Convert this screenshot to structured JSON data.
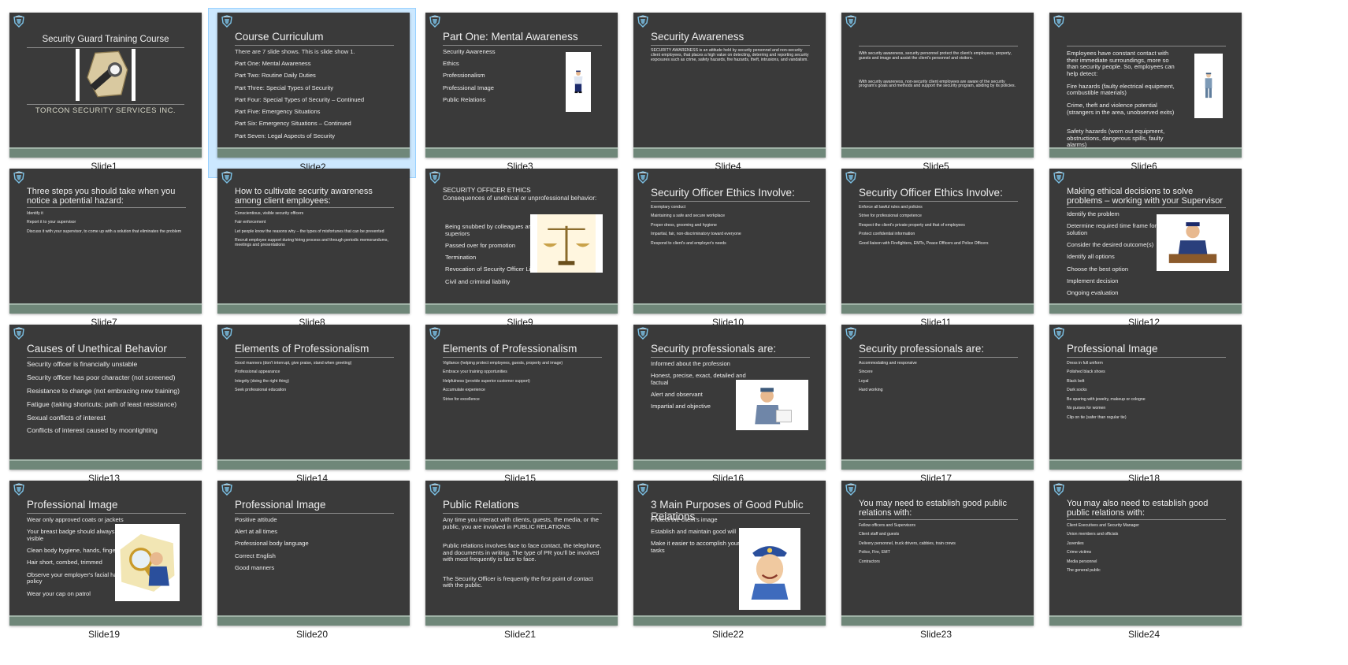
{
  "view": {
    "selected_slide": 2,
    "colors": {
      "slide_bg": "#3a3a3a",
      "footer": "#6f8779",
      "selection_bg": "#cce8ff",
      "selection_border": "#99d1ff",
      "logo": "#7cc3e8"
    }
  },
  "slides": [
    {
      "label": "Slide1",
      "layout": "cover",
      "title": "Security  Guard Training Course",
      "company": "TORCON SECURITY SERVICES INC.",
      "image": "flashlight-badge-image"
    },
    {
      "label": "Slide2",
      "layout": "list",
      "title": "Course Curriculum",
      "intro": "There are 7 slide shows.  This is slide show 1.",
      "size": "m",
      "items": [
        "Part One: Mental Awareness",
        "Part Two: Routine Daily Duties",
        "Part Three: Special Types of Security",
        "Part Four: Special Types of Security – Continued",
        "Part Five: Emergency Situations",
        "Part Six: Emergency Situations – Continued",
        "Part Seven: Legal Aspects of Security"
      ]
    },
    {
      "label": "Slide3",
      "layout": "list-image",
      "title": "Part One: Mental Awareness",
      "size": "m",
      "image": "security-officer-image",
      "items": [
        "Security Awareness",
        "Ethics",
        "Professionalism",
        "Professional Image",
        "Public Relations"
      ]
    },
    {
      "label": "Slide4",
      "layout": "paras",
      "title": "Security Awareness",
      "size": "s",
      "paras": [
        "SECURITY AWARENESS is an attitude held by security personnel and non-security client employees, that places a high value on detecting, deterring and reporting security exposures such as crime, safety hazards, fire hazards, theft, intrusions, and vandalism."
      ]
    },
    {
      "label": "Slide5",
      "layout": "paras",
      "title": "",
      "size": "s",
      "paras": [
        "With security awareness, security personnel protect the client's employees, property, guests and image and assist the client's personnel and visitors.",
        "With security awareness, non-security client employees are aware of the security program's goals and methods and support the security program, abiding by its policies."
      ]
    },
    {
      "label": "Slide6",
      "layout": "paras-image",
      "title": "",
      "size": "m",
      "image": "guard-standing-image",
      "paras": [
        "Employees have constant contact with their immediate surroundings, more so than security people.  So, employees can help detect:",
        "Fire hazards (faulty electrical equipment, combustible materials)",
        "Crime, theft and violence potential (strangers in the area, unobserved exits)",
        "Safety hazards (worn out equipment, obstructions, dangerous spills, faulty alarms)"
      ]
    },
    {
      "label": "Slide7",
      "layout": "list",
      "title": "Three steps you should take when you notice a potential hazard:",
      "size": "s",
      "items": [
        "Identify it",
        "Report it to your supervisor",
        "Discuss it with your supervisor, to come up with a solution that eliminates the problem"
      ]
    },
    {
      "label": "Slide8",
      "layout": "list",
      "title": "How to cultivate security awareness among client employees:",
      "size": "s",
      "items": [
        "Conscientious, visible security officers",
        "Fair enforcement",
        "Let people know the reasons why – the types of misfortunes that can be prevented",
        "Recruit employee support during hiring process and through periodic memorandums, meetings and presentations"
      ]
    },
    {
      "label": "Slide9",
      "layout": "ethics",
      "title": "SECURITY OFFICER ETHICS",
      "subtitle": "Consequences of unethical or unprofessional behavior:",
      "size": "m",
      "image": "scales-of-justice-image",
      "items": [
        "Being snubbed by colleagues and superiors",
        "Passed over for promotion",
        "Termination",
        "Revocation of Security Officer License",
        "Civil and criminal liability"
      ]
    },
    {
      "label": "Slide10",
      "layout": "list",
      "title": "Security Officer Ethics Involve:",
      "size": "s",
      "items": [
        "Exemplary conduct",
        "Maintaining a safe and secure workplace",
        "Proper dress, grooming and hygiene",
        "Impartial, fair, non-discriminatory toward everyone",
        "Respond to client's and employer's needs"
      ]
    },
    {
      "label": "Slide11",
      "layout": "list",
      "title": "Security Officer Ethics Involve:",
      "size": "s",
      "items": [
        "Enforce all lawful rules and policies",
        "Strive for professional competence",
        "Respect the client's private property and that of employees",
        "Protect confidential information",
        "Good liaison with Firefighters, EMTs, Peace Officers and Police Officers"
      ]
    },
    {
      "label": "Slide12",
      "layout": "list-image",
      "title": "Making ethical decisions to solve problems – working with your Supervisor",
      "size": "m",
      "image": "supervisor-desk-image",
      "items": [
        "Identify the problem",
        "Determine required time frame for solution",
        "Consider the desired outcome(s)",
        "Identify all options",
        "Choose the best option",
        "Implement decision",
        "Ongoing evaluation"
      ]
    },
    {
      "label": "Slide13",
      "layout": "list",
      "title": "Causes of Unethical Behavior",
      "size": "l",
      "items": [
        "Security officer is financially unstable",
        "Security officer has poor character (not screened)",
        "Resistance to change (not embracing new training)",
        "Fatigue (taking shortcuts; path of least resistance)",
        "Sexual conflicts of interest",
        "Conflicts of interest caused by moonlighting"
      ]
    },
    {
      "label": "Slide14",
      "layout": "list",
      "title": "Elements of Professionalism",
      "size": "s",
      "items": [
        "Good manners (don't interrupt, give praise, stand when greeting)",
        "Professional appearance",
        "Integrity (doing the right thing)",
        "Seek professional education"
      ]
    },
    {
      "label": "Slide15",
      "layout": "list",
      "title": "Elements of Professionalism",
      "size": "s",
      "items": [
        "Vigilance (helping protect employees, guests, property and image)",
        "Embrace your training opportunities",
        "Helpfulness (provide superior customer support)",
        "Accumulate experience",
        "Strive for excellence"
      ]
    },
    {
      "label": "Slide16",
      "layout": "list-image",
      "title": "Security professionals are:",
      "size": "m",
      "image": "officer-writing-image",
      "items": [
        "Informed about the profession",
        "Honest, precise, exact, detailed and factual",
        "Alert and observant",
        "Impartial and objective"
      ]
    },
    {
      "label": "Slide17",
      "layout": "list",
      "title": "Security professionals are:",
      "size": "s",
      "items": [
        "Accommodating and responsive",
        "Sincere",
        "Loyal",
        "Hard working"
      ]
    },
    {
      "label": "Slide18",
      "layout": "list",
      "title": "Professional Image",
      "size": "s",
      "items": [
        "Dress in full uniform",
        "Polished black shoes",
        "Black belt",
        "Dark socks",
        "Be sparing with jewelry, makeup or cologne",
        "No purses for women",
        " Clip on tie (safer than regular tie)"
      ]
    },
    {
      "label": "Slide19",
      "layout": "list-image",
      "title": "Professional Image",
      "size": "m",
      "image": "detective-magnifier-image",
      "items": [
        "Wear only approved coats or jackets",
        "Your breast badge should always be visible",
        "Clean body hygiene, hands, fingernails",
        "Hair short, combed, trimmed",
        "Observe your employer's facial hair policy",
        "Wear your cap on patrol"
      ]
    },
    {
      "label": "Slide20",
      "layout": "list",
      "title": "Professional Image",
      "size": "m",
      "items": [
        "Positive attitude",
        "Alert at all times",
        "Professional body language",
        "Correct English",
        "Good manners"
      ]
    },
    {
      "label": "Slide21",
      "layout": "paras",
      "title": "Public Relations",
      "size": "m",
      "paras": [
        "Any time you interact with clients, guests, the media, or the public, you are involved in PUBLIC RELATIONS.",
        "Public relations involves face to face contact, the telephone, and documents in writing.  The type of PR you'll be involved with most frequently is face to face.",
        "The Security Officer is frequently the first point of contact with the public."
      ]
    },
    {
      "label": "Slide22",
      "layout": "list-image",
      "title": "3 Main Purposes of Good Public Relations",
      "size": "m",
      "image": "smiling-officer-image",
      "items": [
        "Protect the client's image",
        "Establish and maintain good will",
        "Make it easier to accomplish your job tasks"
      ]
    },
    {
      "label": "Slide23",
      "layout": "list",
      "title": "You may need to establish good public relations with:",
      "size": "s",
      "items": [
        "Fellow officers and Supervisors",
        "Client staff and guests",
        "Delivery personnel, truck drivers, cabbies, train crews",
        "Police, Fire, EMT",
        "Contractors"
      ]
    },
    {
      "label": "Slide24",
      "layout": "list",
      "title": "You may also need to establish good public relations with:",
      "size": "s",
      "items": [
        "Client Executives and Security Manager",
        "Union members and officials",
        "Juveniles",
        "Crime victims",
        "Media personnel",
        "The general public"
      ]
    }
  ]
}
